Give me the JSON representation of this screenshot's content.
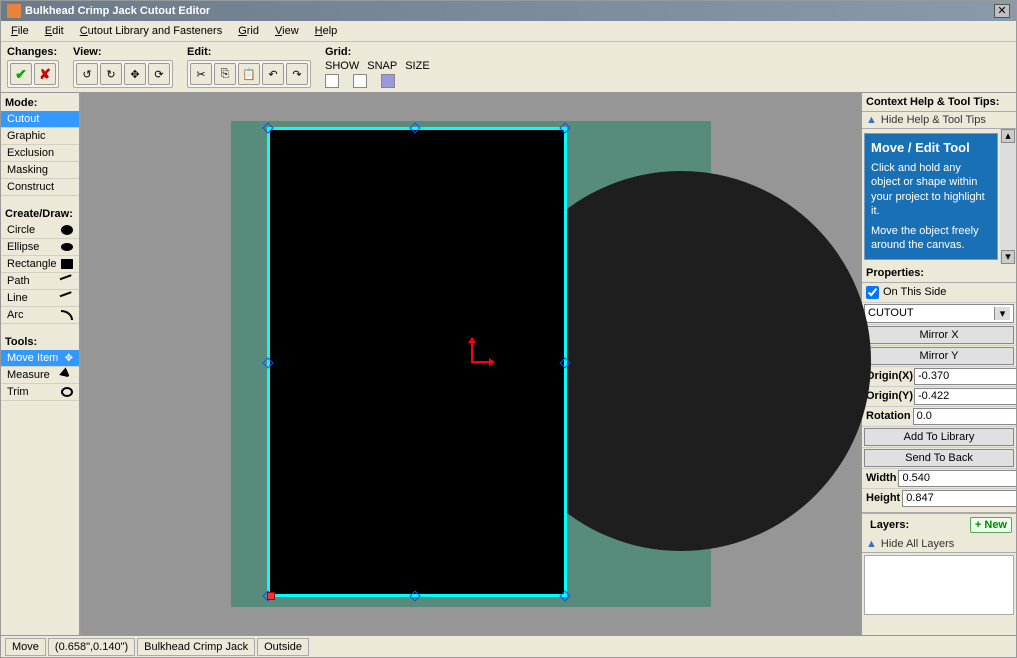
{
  "window": {
    "title": "Bulkhead Crimp Jack Cutout Editor"
  },
  "menu": {
    "file": "File",
    "edit": "Edit",
    "library": "Cutout Library and Fasteners",
    "grid": "Grid",
    "view": "View",
    "help": "Help"
  },
  "toolbar": {
    "changes_label": "Changes:",
    "view_label": "View:",
    "edit_label": "Edit:",
    "grid_label": "Grid:",
    "grid_show": "SHOW",
    "grid_snap": "SNAP",
    "grid_size": "SIZE"
  },
  "left": {
    "mode_label": "Mode:",
    "modes": {
      "cutout": "Cutout",
      "graphic": "Graphic",
      "exclusion": "Exclusion",
      "masking": "Masking",
      "construct": "Construct"
    },
    "create_label": "Create/Draw:",
    "shapes": {
      "circle": "Circle",
      "ellipse": "Ellipse",
      "rectangle": "Rectangle",
      "path": "Path",
      "line": "Line",
      "arc": "Arc"
    },
    "tools_label": "Tools:",
    "tools": {
      "move": "Move Item",
      "measure": "Measure",
      "trim": "Trim"
    }
  },
  "right": {
    "context_header": "Context Help & Tool Tips:",
    "hide_help": "Hide Help & Tool Tips",
    "help_title": "Move / Edit Tool",
    "help_body1": "Click and hold any object or shape within your project to highlight it.",
    "help_body2": "Move the object freely around the canvas.",
    "properties_header": "Properties:",
    "on_this_side": "On This Side",
    "type_value": "CUTOUT",
    "mirror_x": "Mirror X",
    "mirror_y": "Mirror Y",
    "origin_x_label": "Origin(X)",
    "origin_y_label": "Origin(Y)",
    "origin_x": "-0.370",
    "origin_y": "-0.422",
    "rotation_label": "Rotation",
    "rotation": "0.0",
    "add_library": "Add To Library",
    "send_back": "Send To Back",
    "width_label": "Width",
    "width": "0.540",
    "height_label": "Height",
    "height": "0.847",
    "layers_header": "Layers:",
    "new_btn": "+ New",
    "hide_layers": "Hide All Layers"
  },
  "status": {
    "mode": "Move",
    "coords": "(0.658\",0.140\")",
    "name": "Bulkhead Crimp Jack",
    "side": "Outside"
  }
}
